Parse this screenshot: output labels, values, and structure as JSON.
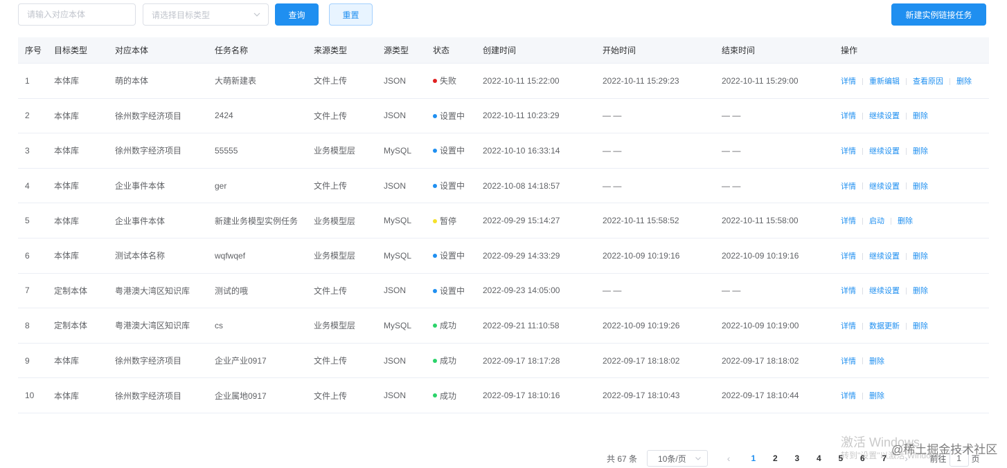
{
  "toolbar": {
    "entity_placeholder": "请输入对应本体",
    "type_placeholder": "请选择目标类型",
    "query_label": "查询",
    "reset_label": "重置",
    "create_label": "新建实例链接任务"
  },
  "table": {
    "headers": [
      "序号",
      "目标类型",
      "对应本体",
      "任务名称",
      "来源类型",
      "源类型",
      "状态",
      "创建时间",
      "开始时间",
      "结束时间",
      "操作"
    ],
    "rows": [
      {
        "no": "1",
        "target": "本体库",
        "entity": "萌的本体",
        "name": "大萌新建表",
        "source": "文件上传",
        "src_type": "JSON",
        "status": "失败",
        "status_color": "#e02020",
        "created": "2022-10-11 15:22:00",
        "start": "2022-10-11 15:29:23",
        "end": "2022-10-11 15:29:00",
        "actions": [
          "详情",
          "重新编辑",
          "查看原因",
          "删除"
        ]
      },
      {
        "no": "2",
        "target": "本体库",
        "entity": "徐州数字经济项目",
        "name": "2424",
        "source": "文件上传",
        "src_type": "JSON",
        "status": "设置中",
        "status_color": "#1f8ff0",
        "created": "2022-10-11 10:23:29",
        "start": "— —",
        "end": "— —",
        "actions": [
          "详情",
          "继续设置",
          "删除"
        ]
      },
      {
        "no": "3",
        "target": "本体库",
        "entity": "徐州数字经济项目",
        "name": "55555",
        "source": "业务模型层",
        "src_type": "MySQL",
        "status": "设置中",
        "status_color": "#1f8ff0",
        "created": "2022-10-10 16:33:14",
        "start": "— —",
        "end": "— —",
        "actions": [
          "详情",
          "继续设置",
          "删除"
        ]
      },
      {
        "no": "4",
        "target": "本体库",
        "entity": "企业事件本体",
        "name": "ger",
        "source": "文件上传",
        "src_type": "JSON",
        "status": "设置中",
        "status_color": "#1f8ff0",
        "created": "2022-10-08 14:18:57",
        "start": "— —",
        "end": "— —",
        "actions": [
          "详情",
          "继续设置",
          "删除"
        ]
      },
      {
        "no": "5",
        "target": "本体库",
        "entity": "企业事件本体",
        "name": "新建业务模型实例任务",
        "source": "业务模型层",
        "src_type": "MySQL",
        "status": "暂停",
        "status_color": "#f5e12b",
        "created": "2022-09-29 15:14:27",
        "start": "2022-10-11 15:58:52",
        "end": "2022-10-11 15:58:00",
        "actions": [
          "详情",
          "启动",
          "删除"
        ]
      },
      {
        "no": "6",
        "target": "本体库",
        "entity": "测试本体名称",
        "name": "wqfwqef",
        "source": "业务模型层",
        "src_type": "MySQL",
        "status": "设置中",
        "status_color": "#1f8ff0",
        "created": "2022-09-29 14:33:29",
        "start": "2022-10-09 10:19:16",
        "end": "2022-10-09 10:19:16",
        "actions": [
          "详情",
          "继续设置",
          "删除"
        ]
      },
      {
        "no": "7",
        "target": "定制本体",
        "entity": "粤港澳大湾区知识库",
        "name": "测试的哦",
        "source": "文件上传",
        "src_type": "JSON",
        "status": "设置中",
        "status_color": "#1f8ff0",
        "created": "2022-09-23 14:05:00",
        "start": "— —",
        "end": "— —",
        "actions": [
          "详情",
          "继续设置",
          "删除"
        ]
      },
      {
        "no": "8",
        "target": "定制本体",
        "entity": "粤港澳大湾区知识库",
        "name": "cs",
        "source": "业务模型层",
        "src_type": "MySQL",
        "status": "成功",
        "status_color": "#2bd36a",
        "created": "2022-09-21 11:10:58",
        "start": "2022-10-09 10:19:26",
        "end": "2022-10-09 10:19:00",
        "actions": [
          "详情",
          "数据更新",
          "删除"
        ]
      },
      {
        "no": "9",
        "target": "本体库",
        "entity": "徐州数字经济项目",
        "name": "企业产业0917",
        "source": "文件上传",
        "src_type": "JSON",
        "status": "成功",
        "status_color": "#2bd36a",
        "created": "2022-09-17 18:17:28",
        "start": "2022-09-17 18:18:02",
        "end": "2022-09-17 18:18:02",
        "actions": [
          "详情",
          "删除"
        ]
      },
      {
        "no": "10",
        "target": "本体库",
        "entity": "徐州数字经济项目",
        "name": "企业属地0917",
        "source": "文件上传",
        "src_type": "JSON",
        "status": "成功",
        "status_color": "#2bd36a",
        "created": "2022-09-17 18:10:16",
        "start": "2022-09-17 18:10:43",
        "end": "2022-09-17 18:10:44",
        "actions": [
          "详情",
          "删除"
        ]
      }
    ]
  },
  "pagination": {
    "total_text": "共 67 条",
    "page_size": "10条/页",
    "prev_icon": "chevron-left-icon",
    "next_icon": "chevron-right-icon",
    "pages": [
      "1",
      "2",
      "3",
      "4",
      "5",
      "6",
      "7"
    ],
    "current_page": "1",
    "goto_prefix": "前往",
    "goto_value": "1",
    "goto_suffix": "页"
  },
  "watermarks": {
    "windows_title": "激活 Windows",
    "windows_sub": "转到\"设置\"以激活 Windows。",
    "juejin": "@稀土掘金技术社区"
  },
  "colors": {
    "primary": "#1f8ff0",
    "fail": "#e02020",
    "running": "#1f8ff0",
    "paused": "#f5e12b",
    "success": "#2bd36a"
  }
}
